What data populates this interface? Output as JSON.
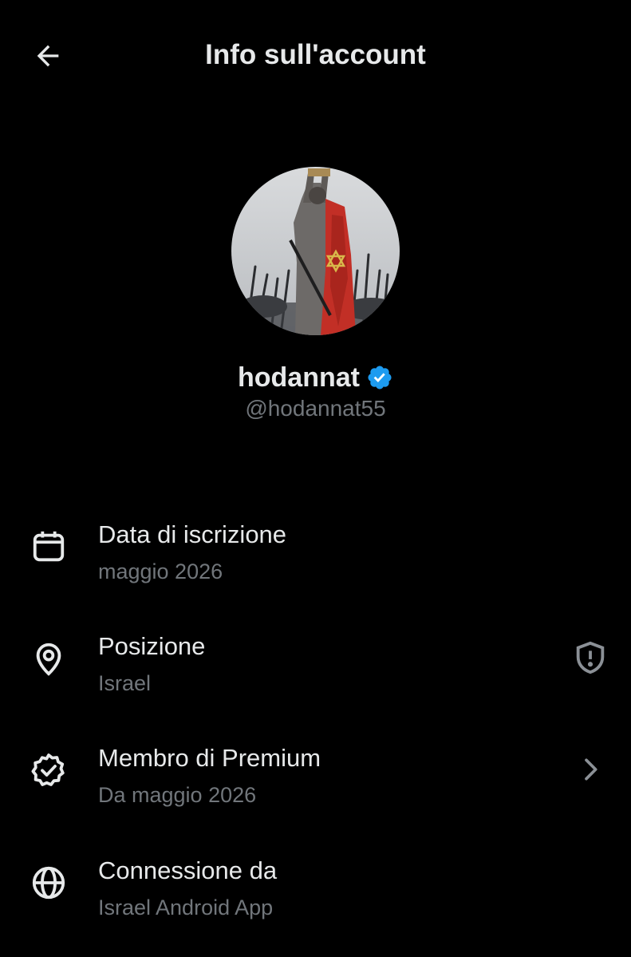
{
  "header": {
    "title": "Info sull'account",
    "back_icon": "arrow-left-icon"
  },
  "profile": {
    "avatar_description": "profile-photo",
    "display_name": "hodannat",
    "verified_badge_color": "#1d9bf0",
    "handle": "@hodannat55"
  },
  "rows": [
    {
      "icon": "calendar-icon",
      "label": "Data di iscrizione",
      "value": "maggio 2026"
    },
    {
      "icon": "location-pin-icon",
      "label": "Posizione",
      "value": "Israel",
      "trailing_icon": "shield-alert-icon"
    },
    {
      "icon": "verified-badge-icon",
      "label": "Membro di Premium",
      "value": "Da maggio 2026",
      "trailing_icon": "chevron-right-icon"
    },
    {
      "icon": "globe-icon",
      "label": "Connessione da",
      "value": "Israel Android App"
    }
  ],
  "colors": {
    "background": "#000000",
    "primary_text": "#e7e9ea",
    "secondary_text": "#71767b",
    "accent": "#1d9bf0"
  }
}
